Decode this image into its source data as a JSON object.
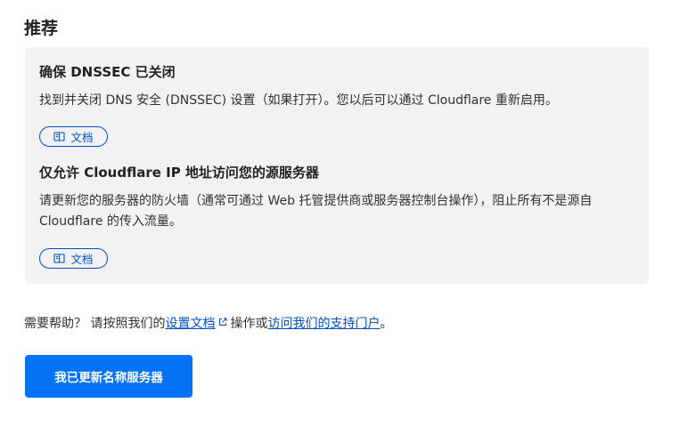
{
  "page": {
    "title": "推荐"
  },
  "recommendations": [
    {
      "title": "确保 DNSSEC 已关闭",
      "description": "找到并关闭 DNS 安全 (DNSSEC) 设置（如果打开）。您以后可以通过 Cloudflare 重新启用。",
      "doc_label": "文档",
      "doc_icon": "book-icon"
    },
    {
      "title": "仅允许 Cloudflare IP 地址访问您的源服务器",
      "description": "请更新您的服务器的防火墙（通常可通过 Web 托管提供商或服务器控制台操作），阻止所有不是源自 Cloudflare 的传入流量。",
      "doc_label": "文档",
      "doc_icon": "book-icon"
    }
  ],
  "help": {
    "prefix": "需要帮助？ 请按照我们的",
    "setup_docs_link": "设置文档",
    "external_icon": "external-link-icon",
    "middle": "操作或",
    "support_portal_link": "访问我们的支持门户",
    "suffix": "。"
  },
  "primary_button": {
    "label": "我已更新名称服务器"
  },
  "colors": {
    "accent": "#0672f5",
    "link": "#0051c3",
    "panel_bg": "#f2f2f2",
    "text": "#313131"
  }
}
